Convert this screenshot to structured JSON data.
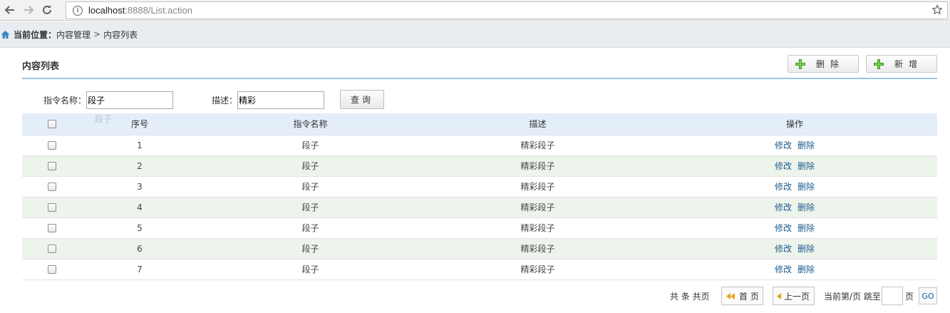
{
  "browser": {
    "url_host": "localhost",
    "url_rest": ":8888/List.action"
  },
  "breadcrumb": {
    "label": "当前位置：",
    "items": [
      "内容管理",
      "内容列表"
    ],
    "separator": ">"
  },
  "panel": {
    "title": "内容列表",
    "delete_label": "删除",
    "add_label": "新增"
  },
  "search": {
    "command_label": "指令名称：",
    "command_value": "段子",
    "desc_label": "描述：",
    "desc_value": "精彩",
    "query_label": "查询",
    "autocomplete_hint": "段子"
  },
  "table": {
    "headers": [
      "序号",
      "指令名称",
      "描述",
      "操作"
    ],
    "rows": [
      {
        "no": "1",
        "name": "段子",
        "desc": "精彩段子"
      },
      {
        "no": "2",
        "name": "段子",
        "desc": "精彩段子"
      },
      {
        "no": "3",
        "name": "段子",
        "desc": "精彩段子"
      },
      {
        "no": "4",
        "name": "段子",
        "desc": "精彩段子"
      },
      {
        "no": "5",
        "name": "段子",
        "desc": "精彩段子"
      },
      {
        "no": "6",
        "name": "段子",
        "desc": "精彩段子"
      },
      {
        "no": "7",
        "name": "段子",
        "desc": "精彩段子"
      }
    ],
    "edit_label": "修改",
    "delete_label": "删除"
  },
  "pager": {
    "summary": "共 条 共页",
    "first_label": "首 页",
    "prev_label": "上一页",
    "current_label": "当前第/页 跳至",
    "page_unit": "页",
    "go_label": "GO"
  },
  "colors": {
    "accent_line": "#9cc3e6",
    "header_bg": "#e3eef9",
    "alt_row_bg": "#edf4ec",
    "link": "#1d5c8e",
    "plus_icon": "#3a9a2a",
    "pager_arrow": "#e8a317"
  }
}
